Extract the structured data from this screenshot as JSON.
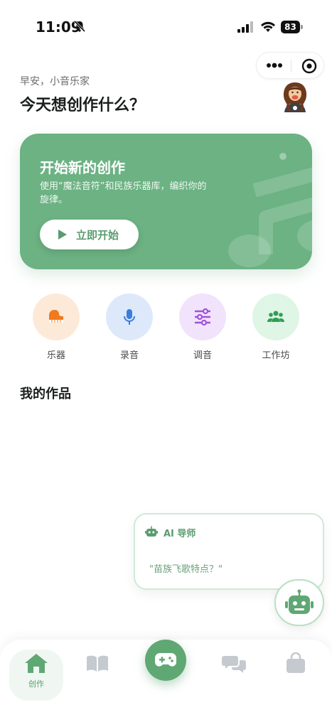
{
  "status_bar": {
    "time": "11:09",
    "battery": "83"
  },
  "header": {
    "greeting": "早安，小音乐家",
    "headline": "今天想创作什么？"
  },
  "hero": {
    "title": "开始新的创作",
    "description": "使用“魔法音符”和民族乐器库，编织你的旋律。",
    "button_label": "立即开始"
  },
  "quick_actions": [
    {
      "label": "乐器",
      "icon": "piano-icon",
      "bg": "#fde9d7",
      "color": "#f07a1e"
    },
    {
      "label": "录音",
      "icon": "microphone-icon",
      "bg": "#dde9fb",
      "color": "#3b7ddd"
    },
    {
      "label": "调音",
      "icon": "sliders-icon",
      "bg": "#f1e3fb",
      "color": "#a252d8"
    },
    {
      "label": "工作坊",
      "icon": "users-icon",
      "bg": "#dff5e6",
      "color": "#2f9e55"
    }
  ],
  "works": {
    "title": "我的作品"
  },
  "ai_tutor": {
    "title": "AI 导师",
    "message": "\"苗族飞歌特点？\""
  },
  "tabbar": {
    "active_label": "创作"
  },
  "colors": {
    "primary": "#6cb283",
    "accent_text": "#5a9c70"
  }
}
